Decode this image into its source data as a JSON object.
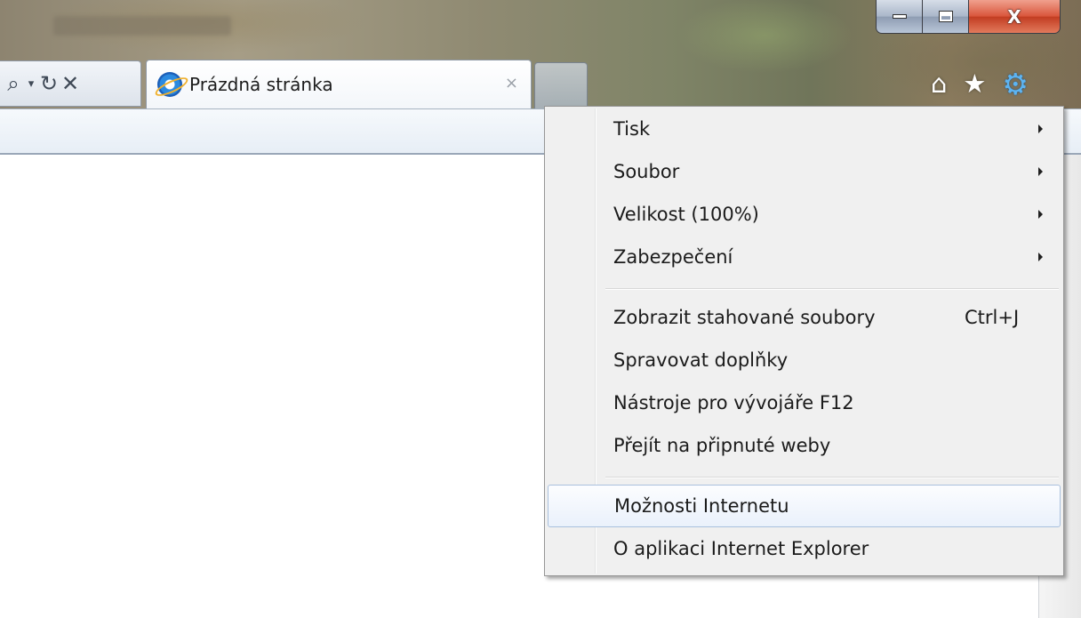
{
  "window": {
    "caption_buttons": {
      "minimize_icon": "minimize-icon",
      "maximize_icon": "maximize-icon",
      "close_label": "X"
    }
  },
  "nav": {
    "search_icon": "search-icon",
    "dropdown_icon": "chevron-down-icon",
    "refresh_icon": "refresh-icon",
    "stop_icon": "stop-icon"
  },
  "tab": {
    "title": "Prázdná stránka",
    "close_label": "×"
  },
  "toolbar_icons": [
    "home-icon",
    "favorites-star-icon",
    "tools-gear-icon"
  ],
  "menu": {
    "items": [
      {
        "label": "Tisk",
        "submenu": true
      },
      {
        "label": "Soubor",
        "submenu": true
      },
      {
        "label": "Velikost (100%)",
        "submenu": true
      },
      {
        "label": "Zabezpečení",
        "submenu": true
      },
      {
        "label": "Zobrazit stahované soubory",
        "shortcut": "Ctrl+J"
      },
      {
        "label": "Spravovat doplňky"
      },
      {
        "label": "Nástroje pro vývojáře F12"
      },
      {
        "label": "Přejít na připnuté weby"
      },
      {
        "label": "Možnosti Internetu",
        "highlighted": true
      },
      {
        "label": "O aplikaci Internet Explorer"
      }
    ]
  },
  "colors": {
    "menu_background": "#f0f0f0",
    "menu_highlight_border": "#a9c0dd",
    "gear_icon": "#5db4f2",
    "close_button": "#c23c21"
  }
}
